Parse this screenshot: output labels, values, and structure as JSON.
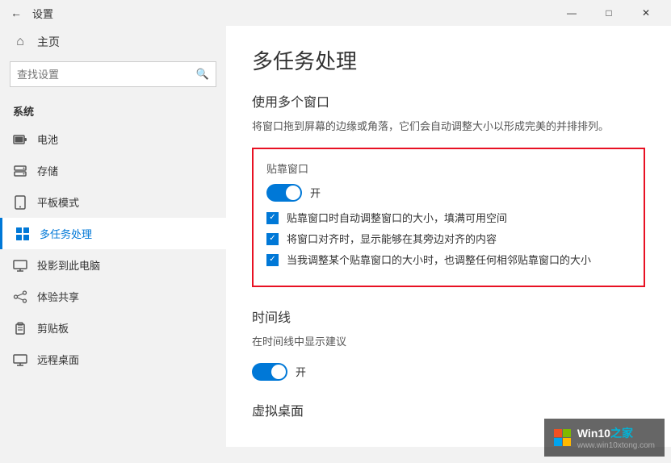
{
  "titlebar": {
    "back_icon": "←",
    "title": "设置",
    "minimize": "—",
    "restore": "□",
    "close": "✕"
  },
  "sidebar": {
    "home_icon": "⌂",
    "home_label": "主页",
    "search_placeholder": "查找设置",
    "search_icon": "🔍",
    "section_label": "系统",
    "items": [
      {
        "id": "battery",
        "icon": "🔋",
        "label": "电池"
      },
      {
        "id": "storage",
        "icon": "💾",
        "label": "存储"
      },
      {
        "id": "tablet",
        "icon": "⬜",
        "label": "平板模式"
      },
      {
        "id": "multitask",
        "icon": "⊞",
        "label": "多任务处理",
        "active": true
      },
      {
        "id": "project",
        "icon": "🖥",
        "label": "投影到此电脑"
      },
      {
        "id": "shared",
        "icon": "✦",
        "label": "体验共享"
      },
      {
        "id": "clipboard",
        "icon": "📋",
        "label": "剪贴板"
      },
      {
        "id": "remote",
        "icon": "⬜",
        "label": "远程桌面"
      }
    ]
  },
  "content": {
    "page_title": "多任务处理",
    "section1_title": "使用多个窗口",
    "section1_desc": "将窗口拖到屏幕的边缘或角落，它们会自动调整大小以形成完美的并排排列。",
    "snap_box": {
      "title": "贴靠窗口",
      "toggle_label": "开",
      "toggle_on": true,
      "options": [
        {
          "id": "opt1",
          "label": "贴靠窗口时自动调整窗口的大小，填满可用空间",
          "checked": true
        },
        {
          "id": "opt2",
          "label": "将窗口对齐时，显示能够在其旁边对齐的内容",
          "checked": true
        },
        {
          "id": "opt3",
          "label": "当我调整某个贴靠窗口的大小时，也调整任何相邻贴靠窗口的大小",
          "checked": true
        }
      ]
    },
    "timeline_title": "时间线",
    "timeline_desc": "在时间线中显示建议",
    "timeline_toggle_label": "开",
    "virtual_desktop_title": "虚拟桌面"
  },
  "watermark": {
    "brand": "Win10",
    "suffix": " 之家",
    "url": "www.win10xtong.com"
  }
}
